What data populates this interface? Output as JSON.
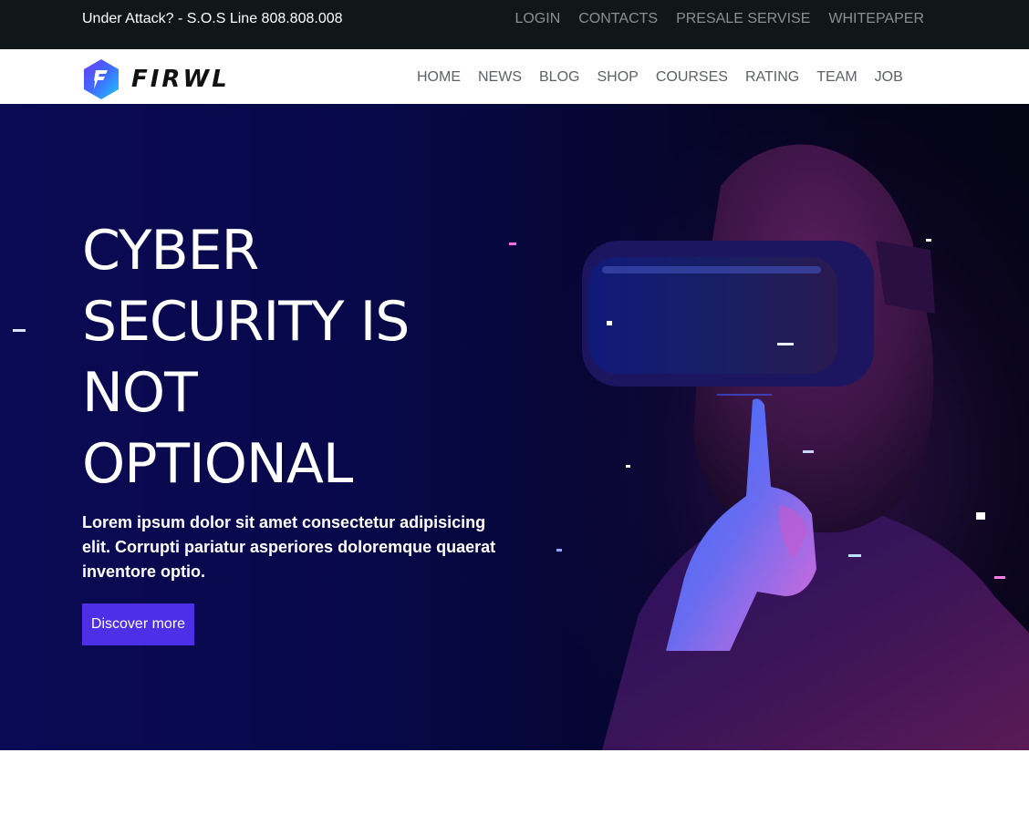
{
  "topbar": {
    "alert_text": "Under Attack? - S.O.S Line 808.808.008",
    "links": [
      "LOGIN",
      "CONTACTS",
      "PRESALE SERVISE",
      "WHITEPAPER"
    ]
  },
  "navbar": {
    "brand": "FIRWL",
    "menu": [
      "HOME",
      "NEWS",
      "BLOG",
      "SHOP",
      "COURSES",
      "RATING",
      "TEAM",
      "JOB"
    ]
  },
  "hero": {
    "title": "CYBER SECURITY IS NOT OPTIONAL",
    "lead": "Lorem ipsum dolor sit amet consectetur adipisicing elit. Corrupti pariatur asperiores doloremque quaerat inventore optio.",
    "cta_label": "Discover more",
    "image_icon": "vr-headset-person-image"
  },
  "colors": {
    "topbar_bg": "#111618",
    "accent": "#4e2fe8",
    "hero_bg": "#07084a",
    "logo_gradient_start": "#4a66ff",
    "logo_gradient_end": "#22c3ff"
  }
}
